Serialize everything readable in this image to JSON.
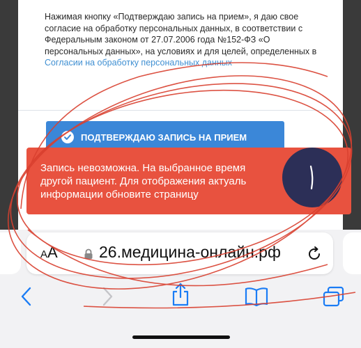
{
  "consent": {
    "text_before_link": "Нажимая кнопку «Подтверждаю запись на прием», я даю свое согласие на обработку персональных данных, в соответствии с Федеральным законом от 27.07.2006 года №152-ФЗ «О персональных данных», на условиях и для целей, определенных в ",
    "link_text": "Согласии на обработку персональных данных"
  },
  "confirm_button": {
    "label": "ПОДТВЕРЖДАЮ ЗАПИСЬ НА ПРИЕМ"
  },
  "toast": {
    "line1": "Запись невозможна. На выбранное время",
    "line2": "другой пациент. Для отображения актуаль",
    "line3": "информации обновите страницу"
  },
  "browser": {
    "aa_small": "A",
    "aa_large": "A",
    "url": "26.медицина-онлайн.рф"
  },
  "colors": {
    "accent": "#3b87d8",
    "error": "#e8523f",
    "link": "#3f8fd2",
    "ios_blue": "#1a7cf5"
  }
}
